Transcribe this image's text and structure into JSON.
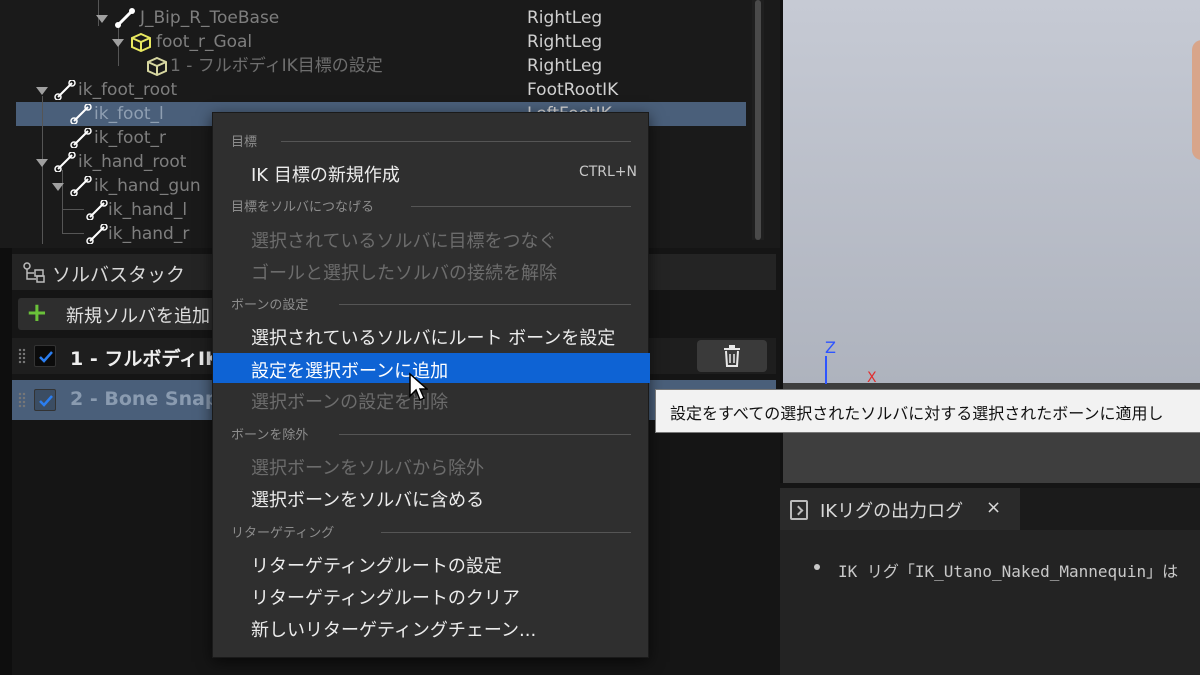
{
  "hierarchy": {
    "rows": [
      {
        "name": "J_Bip_R_ToeBase",
        "chain": "RightLeg"
      },
      {
        "name": "foot_r_Goal",
        "chain": "RightLeg"
      },
      {
        "name": "1 - フルボディIK目標の設定",
        "chain": "RightLeg"
      },
      {
        "name": "ik_foot_root",
        "chain": "FootRootIK"
      },
      {
        "name": "ik_foot_l",
        "chain": "LeftFootIK"
      },
      {
        "name": "ik_foot_r",
        "chain": ""
      },
      {
        "name": "ik_hand_root",
        "chain": ""
      },
      {
        "name": "ik_hand_gun",
        "chain": ""
      },
      {
        "name": "ik_hand_l",
        "chain": ""
      },
      {
        "name": "ik_hand_r",
        "chain": ""
      }
    ]
  },
  "solver_stack": {
    "title": "ソルバスタック",
    "add_button": "新規ソルバを追加",
    "solvers": [
      {
        "label": "1 - フルボディIK",
        "checked": true
      },
      {
        "label": "2 - Bone Snapper",
        "checked": true
      }
    ]
  },
  "context_menu": {
    "sections": [
      {
        "header": "目標",
        "items": [
          {
            "label": "IK 目標の新規作成",
            "shortcut": "CTRL+N",
            "enabled": true
          }
        ]
      },
      {
        "header": "目標をソルバにつなげる",
        "items": [
          {
            "label": "選択されているソルバに目標をつなぐ",
            "enabled": false
          },
          {
            "label": "ゴールと選択したソルバの接続を解除",
            "enabled": false
          }
        ]
      },
      {
        "header": "ボーンの設定",
        "items": [
          {
            "label": "選択されているソルバにルート ボーンを設定",
            "enabled": true
          },
          {
            "label": "設定を選択ボーンに追加",
            "enabled": true,
            "highlighted": true
          },
          {
            "label": "選択ボーンの設定を削除",
            "enabled": false
          }
        ]
      },
      {
        "header": "ボーンを除外",
        "items": [
          {
            "label": "選択ボーンをソルバから除外",
            "enabled": false
          },
          {
            "label": "選択ボーンをソルバに含める",
            "enabled": true
          }
        ]
      },
      {
        "header": "リターゲティング",
        "items": [
          {
            "label": "リターゲティングルートの設定",
            "enabled": true
          },
          {
            "label": "リターゲティングルートのクリア",
            "enabled": true
          },
          {
            "label": "新しいリターゲティングチェーン...",
            "enabled": true
          }
        ]
      }
    ]
  },
  "tooltip": {
    "text": "設定をすべての選択されたソルバに対する選択されたボーンに適用し"
  },
  "viewport": {
    "axis_z": "Z",
    "axis_x": "X"
  },
  "output_log": {
    "tab_title": "IKリグの出力ログ",
    "close": "×",
    "message": "IK リグ「IK_Utano_Naked_Mannequin」は"
  },
  "colors": {
    "highlight": "#0e63d4",
    "selected_row": "#4a5f7a",
    "checkbox": "#2b7ef0",
    "add_icon": "#6ac13a"
  }
}
